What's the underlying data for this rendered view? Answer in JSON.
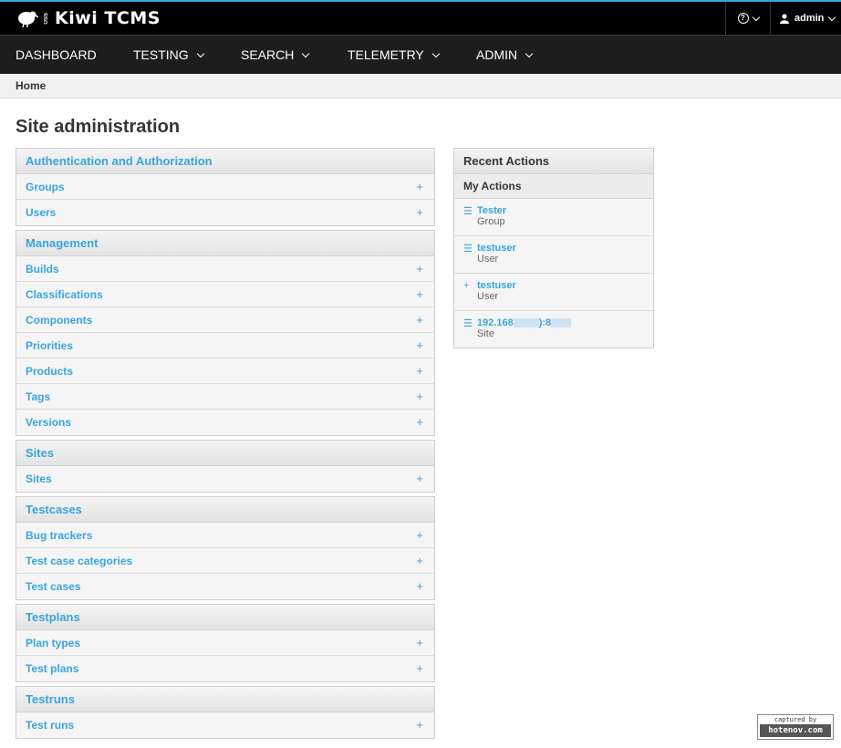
{
  "app": {
    "name": "Kiwi TCMS",
    "logo_small": "OSS",
    "help_icon": "question-circle-icon",
    "user_icon": "user-icon",
    "user": "admin"
  },
  "nav": [
    {
      "label": "DASHBOARD",
      "dropdown": false
    },
    {
      "label": "TESTING",
      "dropdown": true
    },
    {
      "label": "SEARCH",
      "dropdown": true
    },
    {
      "label": "TELEMETRY",
      "dropdown": true
    },
    {
      "label": "ADMIN",
      "dropdown": true
    }
  ],
  "breadcrumb": "Home",
  "page_title": "Site administration",
  "modules": [
    {
      "title": "Authentication and Authorization",
      "items": [
        "Groups",
        "Users"
      ]
    },
    {
      "title": "Management",
      "items": [
        "Builds",
        "Classifications",
        "Components",
        "Priorities",
        "Products",
        "Tags",
        "Versions"
      ]
    },
    {
      "title": "Sites",
      "items": [
        "Sites"
      ]
    },
    {
      "title": "Testcases",
      "items": [
        "Bug trackers",
        "Test case categories",
        "Test cases"
      ]
    },
    {
      "title": "Testplans",
      "items": [
        "Plan types",
        "Test plans"
      ]
    },
    {
      "title": "Testruns",
      "items": [
        "Test runs"
      ]
    }
  ],
  "add_symbol": "+",
  "recent": {
    "title": "Recent Actions",
    "subtitle": "My Actions",
    "actions": [
      {
        "icon": "change-icon",
        "symbol": "☰",
        "title": "Tester",
        "type": "Group"
      },
      {
        "icon": "change-icon",
        "symbol": "☰",
        "title": "testuser",
        "type": "User"
      },
      {
        "icon": "add-icon",
        "symbol": "+",
        "title": "testuser",
        "type": "User"
      },
      {
        "icon": "change-icon",
        "symbol": "☰",
        "title_parts": [
          "192.168",
          "):8"
        ],
        "type": "Site"
      }
    ]
  },
  "badge": {
    "top": "captured by",
    "bottom": "hotenov.com"
  },
  "colors": {
    "accent": "#39a5dc",
    "topbar": "#000000",
    "navbar": "#1d1d1d"
  }
}
